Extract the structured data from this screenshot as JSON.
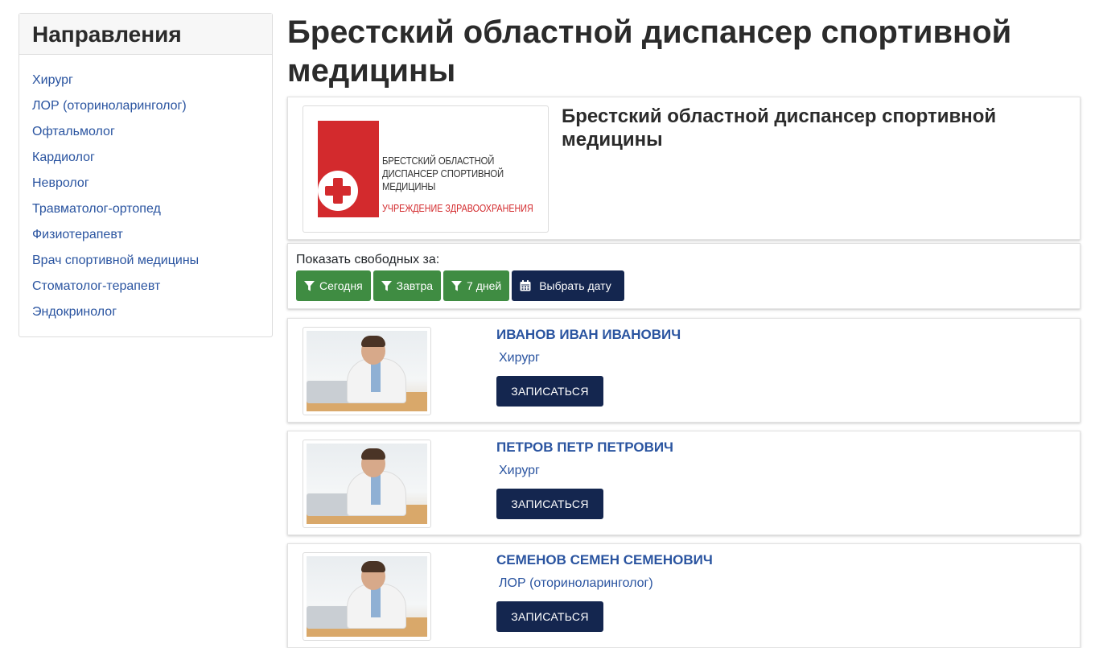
{
  "sidebar": {
    "title": "Направления",
    "items": [
      {
        "label": "Хирург"
      },
      {
        "label": "ЛОР (оториноларинголог)"
      },
      {
        "label": "Офтальмолог"
      },
      {
        "label": "Кардиолог"
      },
      {
        "label": "Невролог"
      },
      {
        "label": "Травматолог-ортопед"
      },
      {
        "label": "Физиотерапевт"
      },
      {
        "label": "Врач спортивной медицины"
      },
      {
        "label": "Стоматолог-терапевт"
      },
      {
        "label": "Эндокринолог"
      }
    ]
  },
  "page": {
    "title": "Брестский областной диспансер спортивной медицины"
  },
  "organization": {
    "name": "Брестский областной диспансер спортивной медицины",
    "logo": {
      "text_lines": [
        "БРЕСТСКИЙ ОБЛАСТНОЙ",
        "ДИСПАНСЕР СПОРТИВНОЙ",
        "МЕДИЦИНЫ"
      ],
      "subtitle": "УЧРЕЖДЕНИЕ ЗДРАВООХРАНЕНИЯ",
      "brand_color": "#d32a2d"
    }
  },
  "filters": {
    "label": "Показать свободных за:",
    "buttons": [
      {
        "label": "Сегодня",
        "icon": "filter-icon"
      },
      {
        "label": "Завтра",
        "icon": "filter-icon"
      },
      {
        "label": "7 дней",
        "icon": "filter-icon"
      }
    ],
    "date_button": {
      "label": "Выбрать дату",
      "icon": "calendar-icon"
    }
  },
  "doctors": [
    {
      "name": "ИВАНОВ ИВАН ИВАНОВИЧ",
      "specialty": "Хирург",
      "button": "ЗАПИСАТЬСЯ"
    },
    {
      "name": "ПЕТРОВ ПЕТР ПЕТРОВИЧ",
      "specialty": "Хирург",
      "button": "ЗАПИСАТЬСЯ"
    },
    {
      "name": "СЕМЕНОВ СЕМЕН СЕМЕНОВИЧ",
      "specialty": "ЛОР (оториноларинголог)",
      "button": "ЗАПИСАТЬСЯ"
    }
  ],
  "colors": {
    "link": "#2a54a0",
    "filter_green": "#3f8c42",
    "navy": "#14264f"
  }
}
